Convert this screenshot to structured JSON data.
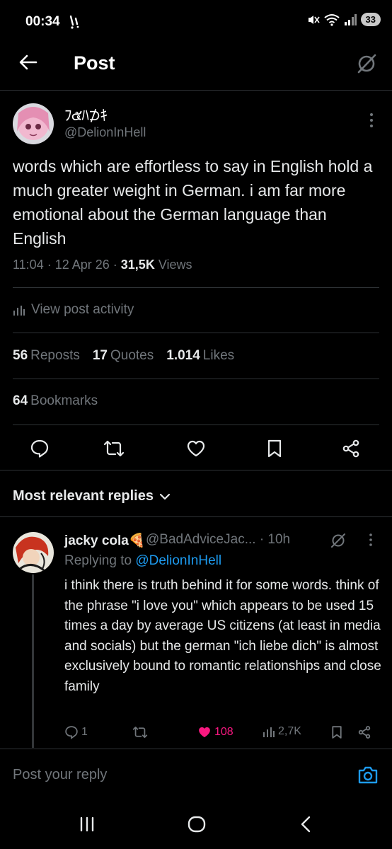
{
  "status_bar": {
    "time": "00:34",
    "battery": "33"
  },
  "header": {
    "title": "Post"
  },
  "post": {
    "author_name": "ﾌ๕ﾊ⊅ｷ",
    "handle": "@DelionInHell",
    "text": "words which are effortless to say in English hold a much greater weight in German. i am far more emotional about the German language than English",
    "time": "11:04",
    "date": "12 Apr 26",
    "views_count": "31,5K",
    "views_label": "Views",
    "activity_label": "View post activity",
    "reposts_count": "56",
    "reposts_label": "Reposts",
    "quotes_count": "17",
    "quotes_label": "Quotes",
    "likes_count": "1.014",
    "likes_label": "Likes",
    "bookmarks_count": "64",
    "bookmarks_label": "Bookmarks"
  },
  "replies_section": {
    "sort_label": "Most relevant replies"
  },
  "reply": {
    "name": "jacky cola",
    "name_emoji": "🍕",
    "handle": "@BadAdviceJac...",
    "time": "· 10h",
    "replying_prefix": "Replying to",
    "replying_to": "@DelionInHell",
    "text": "i think there is truth behind it for some words. think of the phrase \"i love you\" which appears to be used 15 times a day by average US citizens (at least in media and socials) but the german \"ich liebe dich\" is almost exclusively bound to romantic relationships and close family",
    "reply_count": "1",
    "like_count": "108",
    "view_count": "2,7K"
  },
  "compose": {
    "placeholder": "Post your reply"
  },
  "colors": {
    "background": "#000000",
    "text": "#e7e9ea",
    "muted": "#71767b",
    "link": "#1d9bf0",
    "like": "#f91880",
    "divider": "#2f3336"
  }
}
